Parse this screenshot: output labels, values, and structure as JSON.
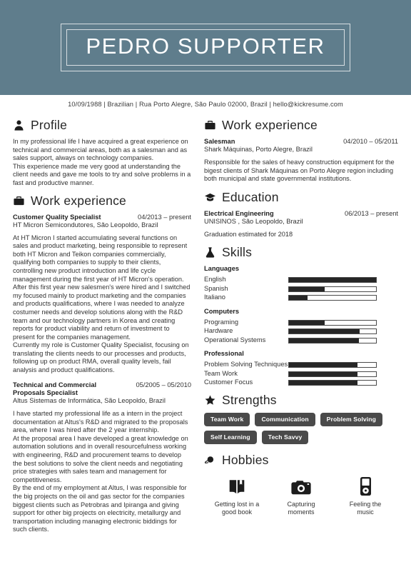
{
  "header": {
    "name": "PEDRO SUPPORTER"
  },
  "contact": {
    "line": "10/09/1988 | Brazilian | Rua Porto Alegre, São Paulo 02000, Brazil | hello@kickresume.com"
  },
  "sections": {
    "profile": "Profile",
    "work_left": "Work experience",
    "work_right": "Work experience",
    "education": "Education",
    "skills": "Skills",
    "strengths": "Strengths",
    "hobbies": "Hobbies"
  },
  "profile": {
    "text": "In my professional life I have acquired a great experience on technical and commercial areas, both as a salesman and as sales support, always on technology companies.\nThis experience made me very good at understanding the client needs and gave me tools to try and solve problems in a fast and productive manner."
  },
  "work_left": [
    {
      "title": "Customer Quality Specialist",
      "date": "04/2013 – present",
      "subtitle": "HT Micron Semicondutores, São Leopoldo, Brazil",
      "description": "At HT Micron I started accumulating several functions on sales and product marketing, being responsible to represent both HT Micron and Teikon companies commercially, qualifying both companies to supply to their clients, controlling new product introduction and life cycle management during the first year of HT Micron's operation.\nAfter this first year new salesmen's were hired and I switched my focused mainly to product marketing and the companies and products qualifications, where I was needed to analyze costumer needs and develop solutions along with the R&D team and our technology partners in Korea and creating reports for product viability and return of investment to present for the companies management.\nCurrently my role is Customer Quality Specialist, focusing on translating the clients needs to our processes and products, following up on product RMA, overall quality levels, fail analysis and product qualifications."
    },
    {
      "title": "Technical and Commercial Proposals Specialist",
      "date": "05/2005 – 05/2010",
      "subtitle": "Altus Sistemas de Informática, São Leopoldo, Brazil",
      "description": "I have started my professional life as a intern in the project documentation at Altus's R&D and migrated to the proposals area, where I was hired after the 2 year internship.\nAt the proposal area I have developed a great knowledge on automation solutions and in overall resourcefulness working with engineering, R&D and procurement teams to develop the best solutions to solve the client needs and negotiating price strategies with sales team and management for competitiveness.\nBy the end of my employment at Altus, I was responsible for the big projects on the oil and gas sector for the companies biggest clients such as Petrobras and Ipiranga and giving support for other big projects on electricity, metallurgy and transportation including managing electronic biddings for such clients."
    }
  ],
  "work_right": [
    {
      "title": "Salesman",
      "date": "04/2010 – 05/2011",
      "subtitle": "Shark Máquinas, Porto Alegre, Brazil",
      "description": "Responsible for the sales of heavy construction equipment for the bigest clients of Shark Máquinas on Porto Alegre region including both municipal and state governmental institutions."
    }
  ],
  "education": [
    {
      "title": "Electrical Engineering",
      "date": "06/2013 – present",
      "subtitle": "UNISINOS , São Leopoldo, Brazil",
      "description": "Graduation estimated for 2018"
    }
  ],
  "skills": [
    {
      "group": "Languages",
      "items": [
        {
          "name": "English",
          "level": 100
        },
        {
          "name": "Spanish",
          "level": 41
        },
        {
          "name": "Italiano",
          "level": 21
        }
      ]
    },
    {
      "group": "Computers",
      "items": [
        {
          "name": "Programing",
          "level": 41
        },
        {
          "name": "Hardware",
          "level": 81
        },
        {
          "name": "Operational Systems",
          "level": 80
        }
      ]
    },
    {
      "group": "Professional",
      "items": [
        {
          "name": "Problem Solving Techniques",
          "level": 79
        },
        {
          "name": "Team Work",
          "level": 79
        },
        {
          "name": "Customer Focus",
          "level": 79
        }
      ]
    }
  ],
  "strengths": [
    "Team Work",
    "Communication",
    "Problem Solving",
    "Self Learning",
    "Tech Savvy"
  ],
  "hobbies": [
    {
      "icon": "book-icon",
      "label": "Getting lost in a\ngood book"
    },
    {
      "icon": "camera-icon",
      "label": "Capturing\nmoments"
    },
    {
      "icon": "music-player-icon",
      "label": "Feeling the\nmusic"
    }
  ],
  "colors": {
    "header_bg": "#5f7d8c",
    "tag_bg": "#4a4a4a",
    "meter_fill": "#262626"
  }
}
